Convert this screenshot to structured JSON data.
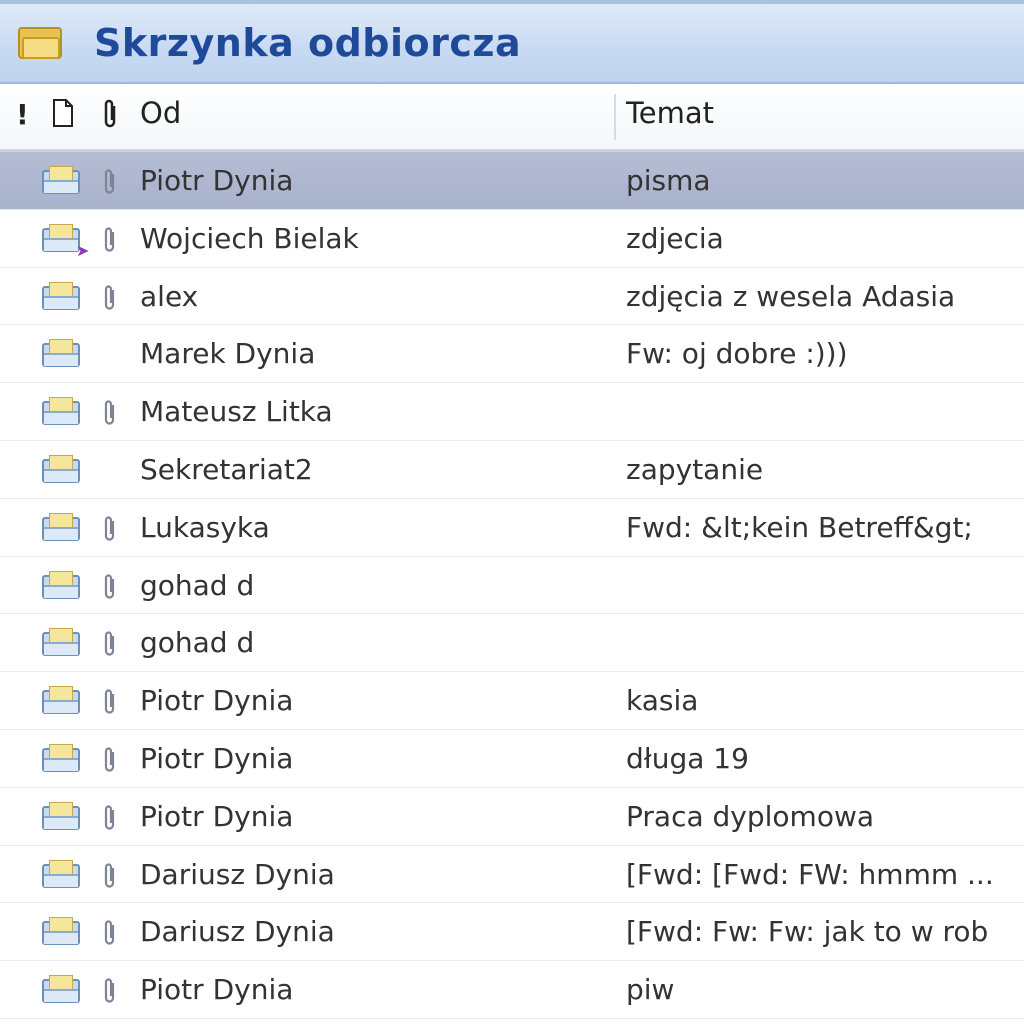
{
  "window": {
    "title": "Skrzynka odbiorcza",
    "folder_icon": "inbox-folder-icon",
    "title_color": "#1f4a9a"
  },
  "columns": {
    "importance_icon": "!",
    "type_icon": "document-icon",
    "attachment_icon": "paperclip-icon",
    "from": "Od",
    "subject": "Temat"
  },
  "messages": [
    {
      "from": "Piotr Dynia",
      "subject": "pisma",
      "attachment": true,
      "selected": true,
      "forwarded": false
    },
    {
      "from": "Wojciech Bielak",
      "subject": "zdjecia",
      "attachment": true,
      "selected": false,
      "forwarded": true
    },
    {
      "from": "alex",
      "subject": "zdjęcia z wesela Adasia",
      "attachment": true,
      "selected": false,
      "forwarded": false
    },
    {
      "from": "Marek Dynia",
      "subject": "Fw: oj dobre :)))",
      "attachment": false,
      "selected": false,
      "forwarded": false
    },
    {
      "from": "Mateusz Litka",
      "subject": "",
      "attachment": true,
      "selected": false,
      "forwarded": false
    },
    {
      "from": "Sekretariat2",
      "subject": "zapytanie",
      "attachment": false,
      "selected": false,
      "forwarded": false
    },
    {
      "from": "Lukasyka",
      "subject": "Fwd: &lt;kein Betreff&gt;",
      "attachment": true,
      "selected": false,
      "forwarded": false
    },
    {
      "from": "gohad d",
      "subject": "",
      "attachment": true,
      "selected": false,
      "forwarded": false
    },
    {
      "from": "gohad d",
      "subject": "",
      "attachment": true,
      "selected": false,
      "forwarded": false
    },
    {
      "from": "Piotr Dynia",
      "subject": "kasia",
      "attachment": true,
      "selected": false,
      "forwarded": false
    },
    {
      "from": "Piotr Dynia",
      "subject": "długa 19",
      "attachment": true,
      "selected": false,
      "forwarded": false
    },
    {
      "from": "Piotr Dynia",
      "subject": "Praca dyplomowa",
      "attachment": true,
      "selected": false,
      "forwarded": false
    },
    {
      "from": "Dariusz Dynia",
      "subject": "[Fwd: [Fwd: FW: hmmm ...",
      "attachment": true,
      "selected": false,
      "forwarded": false
    },
    {
      "from": "Dariusz Dynia",
      "subject": "[Fwd: Fw: Fw: jak to w rob",
      "attachment": true,
      "selected": false,
      "forwarded": false
    },
    {
      "from": "Piotr Dynia",
      "subject": "piw",
      "attachment": true,
      "selected": false,
      "forwarded": false
    }
  ],
  "colors": {
    "selected_row": "#a9b2cc",
    "header_bar": "#c9dbf3",
    "text": "#333333"
  }
}
